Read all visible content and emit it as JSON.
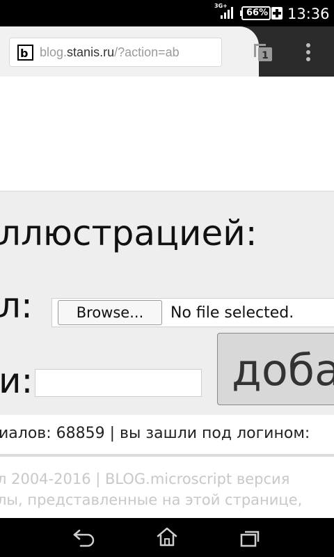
{
  "statusbar": {
    "network": "3G+",
    "battery": "66%",
    "time": "13:36"
  },
  "browser": {
    "url_prefix": "blog.",
    "url_host": "stanis.ru",
    "url_rest": "/?action=ab",
    "favicon_letter": "b",
    "tab_count": "1"
  },
  "form": {
    "heading": "ллюстрацией:",
    "file_label": "л:",
    "browse_label": "Browse...",
    "file_status": "No file selected.",
    "name_label": "и:",
    "name_value": "",
    "add_label": "доба"
  },
  "stats": {
    "text": "иалов: 68859 | вы зашли под логином:"
  },
  "footer": {
    "line1": "л 2004-2016 | BLOG.microscript версия",
    "line2": "лы, представленные на этой странице,"
  }
}
